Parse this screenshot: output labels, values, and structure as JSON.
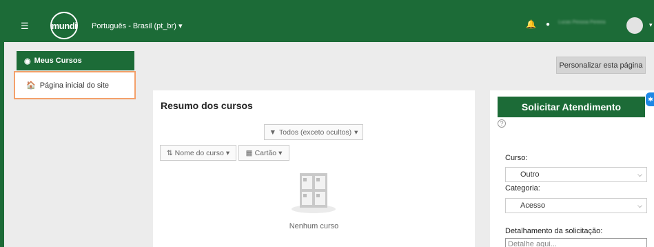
{
  "navbar": {
    "logo_text": "mundi",
    "language": "Português - Brasil (pt_br)",
    "user_name": "Lucas Pessoa Pereira",
    "brand_color": "#1c6b37"
  },
  "drawer": {
    "header_label": "Meus Cursos",
    "items": [
      {
        "label": "Página inicial do site",
        "icon": "home-icon"
      }
    ]
  },
  "main": {
    "customize_label": "Personalizar esta página",
    "course_overview": {
      "title": "Resumo dos cursos",
      "filter_label": "Todos (exceto ocultos)",
      "sort_label": "Nome do curso",
      "view_label": "Cartão",
      "empty_text": "Nenhum curso"
    }
  },
  "support": {
    "button_label": "Solicitar Atendimento",
    "help_glyph": "?",
    "course_label": "Curso:",
    "course_value": "Outro",
    "category_label": "Categoria:",
    "category_value": "Acesso",
    "detail_label": "Detalhamento da solicitação:",
    "detail_placeholder": "Detalhe aqui..."
  }
}
